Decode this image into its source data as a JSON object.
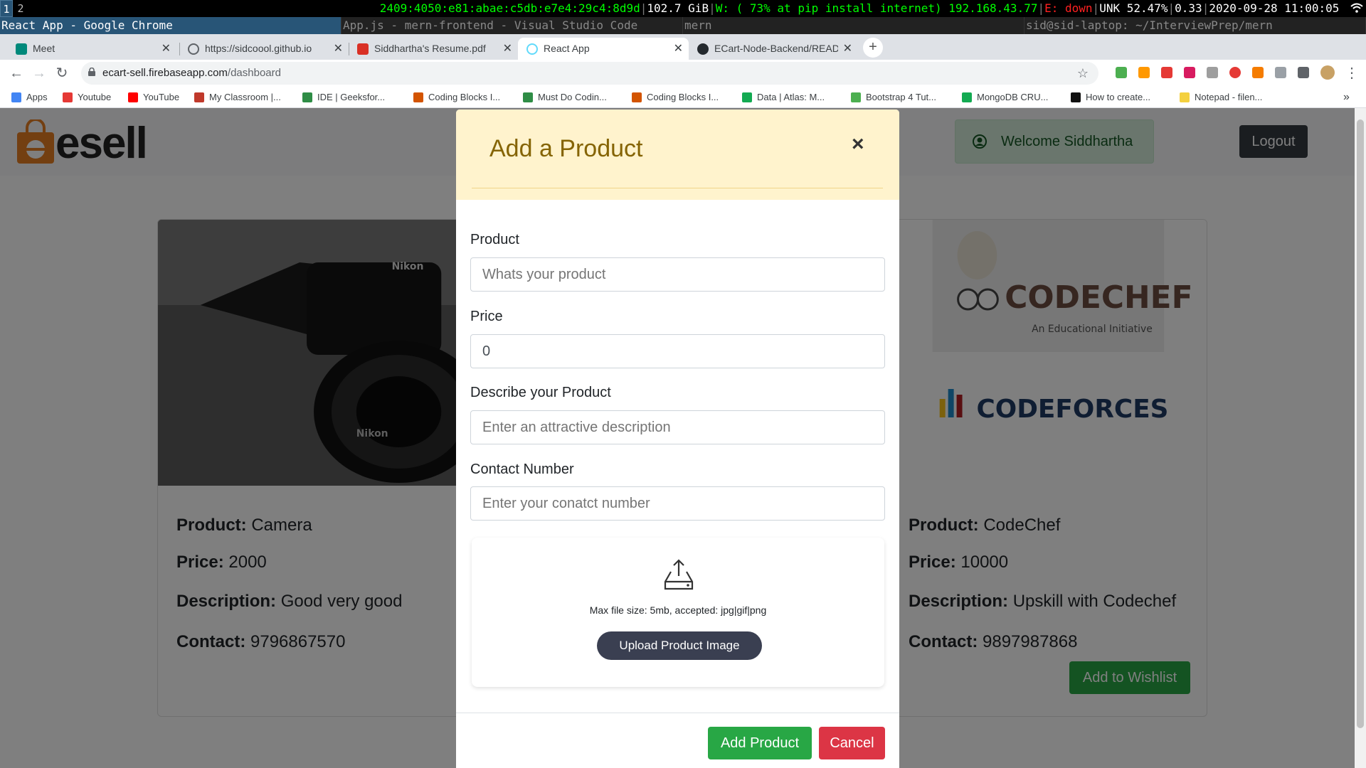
{
  "statusbar": {
    "workspaces": [
      "1",
      "2"
    ],
    "ipv6": "2409:4050:e81:abae:c5db:e7e4:29c4:8d9d",
    "disk": "102.7 GiB",
    "wifi": "W: ( 73% at pip install internet) 192.168.43.77",
    "ethernet": "E: down",
    "battery": "UNK 52.47%",
    "load": "0.33",
    "datetime": "2020-09-28 11:00:05"
  },
  "windows": {
    "browser": "React App - Google Chrome",
    "vscode": "App.js - mern-frontend - Visual Studio Code",
    "mern": "mern",
    "terminal": "sid@sid-laptop: ~/InterviewPrep/mern"
  },
  "tabs": [
    {
      "title": "Meet",
      "active": false
    },
    {
      "title": "https://sidcoool.github.io",
      "active": false
    },
    {
      "title": "Siddhartha's Resume.pdf",
      "active": false
    },
    {
      "title": "React App",
      "active": true
    },
    {
      "title": "ECart-Node-Backend/README",
      "active": false
    }
  ],
  "omnibox": {
    "host": "ecart-sell.firebaseapp.com",
    "path": "/dashboard"
  },
  "bookmarks": [
    {
      "label": "Apps",
      "color": "#4285f4"
    },
    {
      "label": "Youtube",
      "color": "#e53935"
    },
    {
      "label": "YouTube",
      "color": "#ff0000"
    },
    {
      "label": "My Classroom |...",
      "color": "#c0392b"
    },
    {
      "label": "IDE | Geeksfor...",
      "color": "#2f8d46"
    },
    {
      "label": "Coding Blocks I...",
      "color": "#d35400"
    },
    {
      "label": "Must Do Codin...",
      "color": "#2f8d46"
    },
    {
      "label": "Coding Blocks I...",
      "color": "#d35400"
    },
    {
      "label": "Data | Atlas: M...",
      "color": "#13aa52"
    },
    {
      "label": "Bootstrap 4 Tut...",
      "color": "#4caf50"
    },
    {
      "label": "MongoDB CRU...",
      "color": "#13aa52"
    },
    {
      "label": "How to create...",
      "color": "#111111"
    },
    {
      "label": "Notepad - filen...",
      "color": "#f4d03f"
    }
  ],
  "app": {
    "logo": "esell",
    "welcome": "Welcome Siddhartha",
    "logout": "Logout",
    "wishlist": "Add to Wishlist"
  },
  "products": [
    {
      "product_label": "Product:",
      "product": "Camera",
      "price_label": "Price:",
      "price": "2000",
      "description_label": "Description:",
      "description": "Good very good",
      "contact_label": "Contact:",
      "contact": "9796867570"
    },
    {
      "product_label": "Product:",
      "product": "CodeChef",
      "price_label": "Price:",
      "price": "10000",
      "description_label": "Description:",
      "description": "Upskill with Codechef",
      "contact_label": "Contact:",
      "contact": "9897987868",
      "image_text_1": "CODECHEF",
      "image_text_2": "An Educational Initiative",
      "image_text_3": "CODEFORCES"
    }
  ],
  "modal": {
    "title": "Add a Product",
    "close": "×",
    "fields": {
      "product_label": "Product",
      "product_placeholder": "Whats your product",
      "price_label": "Price",
      "price_value": "0",
      "description_label": "Describe your Product",
      "description_placeholder": "Enter an attractive description",
      "contact_label": "Contact Number",
      "contact_placeholder": "Enter your conatct number"
    },
    "upload_hint": "Max file size: 5mb, accepted: jpg|gif|png",
    "upload_button": "Upload Product Image",
    "submit": "Add Product",
    "cancel": "Cancel"
  },
  "colors": {
    "modal_header": "#fff3cd",
    "success": "#28a745",
    "danger": "#dc3545",
    "dark": "#343a40"
  }
}
